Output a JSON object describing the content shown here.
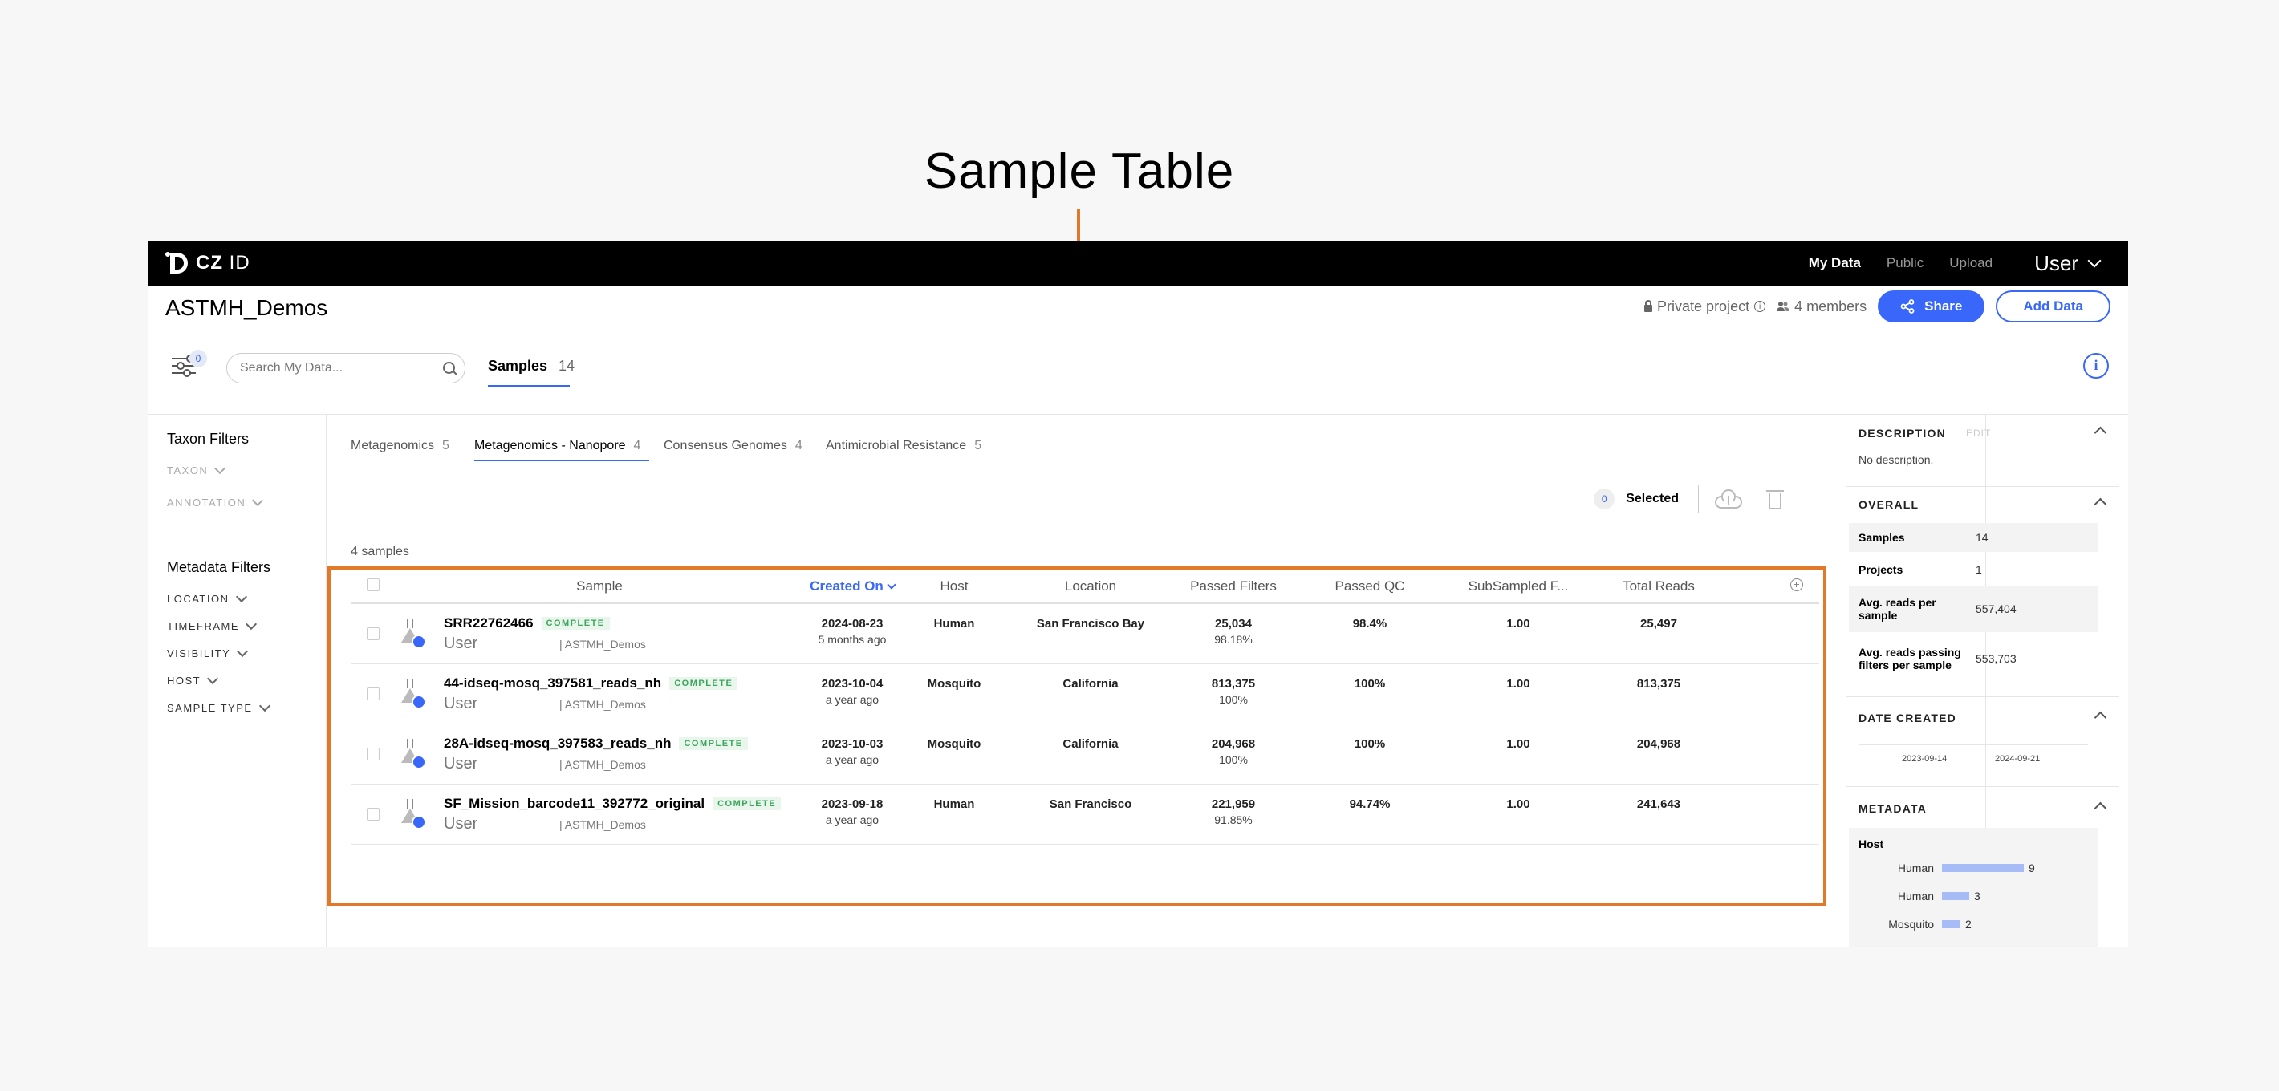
{
  "annotation": {
    "title": "Sample Table"
  },
  "nav": {
    "logo_bold": "CZ",
    "logo_light": "ID",
    "links": [
      "My Data",
      "Public",
      "Upload"
    ],
    "user": "User"
  },
  "header": {
    "project_name": "ASTMH_Demos",
    "privacy": "Private project",
    "members": "4 members",
    "share_label": "Share",
    "add_data_label": "Add Data",
    "filter_count": "0",
    "search_placeholder": "Search My Data...",
    "tab_label": "Samples",
    "tab_count": "14"
  },
  "filters": {
    "taxon_title": "Taxon Filters",
    "taxon_items": [
      "TAXON",
      "ANNOTATION"
    ],
    "metadata_title": "Metadata Filters",
    "metadata_items": [
      "LOCATION",
      "TIMEFRAME",
      "VISIBILITY",
      "HOST",
      "SAMPLE TYPE"
    ]
  },
  "workflow_tabs": [
    {
      "label": "Metagenomics",
      "count": "5"
    },
    {
      "label": "Metagenomics - Nanopore",
      "count": "4"
    },
    {
      "label": "Consensus Genomes",
      "count": "4"
    },
    {
      "label": "Antimicrobial Resistance",
      "count": "5"
    }
  ],
  "selection": {
    "count": "0",
    "label": "Selected"
  },
  "samples_count": "4 samples",
  "table": {
    "columns": [
      "Sample",
      "Created On",
      "Host",
      "Location",
      "Passed Filters",
      "Passed QC",
      "SubSampled F...",
      "Total Reads"
    ],
    "rows": [
      {
        "name": "SRR22762466",
        "status": "COMPLETE",
        "user": "User",
        "project": "| ASTMH_Demos",
        "date": "2024-08-23",
        "ago": "5 months ago",
        "host": "Human",
        "location": "San Francisco Bay",
        "passed_filters": "25,034",
        "passed_filters_pct": "98.18%",
        "passed_qc": "98.4%",
        "subsampled": "1.00",
        "total_reads": "25,497"
      },
      {
        "name": "44-idseq-mosq_397581_reads_nh",
        "status": "COMPLETE",
        "user": "User",
        "project": "| ASTMH_Demos",
        "date": "2023-10-04",
        "ago": "a year ago",
        "host": "Mosquito",
        "location": "California",
        "passed_filters": "813,375",
        "passed_filters_pct": "100%",
        "passed_qc": "100%",
        "subsampled": "1.00",
        "total_reads": "813,375"
      },
      {
        "name": "28A-idseq-mosq_397583_reads_nh",
        "status": "COMPLETE",
        "user": "User",
        "project": "| ASTMH_Demos",
        "date": "2023-10-03",
        "ago": "a year ago",
        "host": "Mosquito",
        "location": "California",
        "passed_filters": "204,968",
        "passed_filters_pct": "100%",
        "passed_qc": "100%",
        "subsampled": "1.00",
        "total_reads": "204,968"
      },
      {
        "name": "SF_Mission_barcode11_392772_original",
        "status": "COMPLETE",
        "user": "User",
        "project": "| ASTMH_Demos",
        "date": "2023-09-18",
        "ago": "a year ago",
        "host": "Human",
        "location": "San Francisco",
        "passed_filters": "221,959",
        "passed_filters_pct": "91.85%",
        "passed_qc": "94.74%",
        "subsampled": "1.00",
        "total_reads": "241,643"
      }
    ]
  },
  "sidebar": {
    "description_title": "DESCRIPTION",
    "edit_label": "EDIT",
    "description_text": "No description.",
    "overall_title": "OVERALL",
    "overall": [
      {
        "label": "Samples",
        "value": "14"
      },
      {
        "label": "Projects",
        "value": "1"
      },
      {
        "label": "Avg. reads per sample",
        "value": "557,404"
      },
      {
        "label": "Avg. reads passing filters per sample",
        "value": "553,703"
      }
    ],
    "date_created_title": "DATE CREATED",
    "date_start": "2023-09-14",
    "date_end": "2024-09-21",
    "metadata_title": "METADATA",
    "host_label": "Host",
    "host_histogram": [
      {
        "label": "Human",
        "count": 9
      },
      {
        "label": "Human",
        "count": 3
      },
      {
        "label": "Mosquito",
        "count": 2
      }
    ]
  },
  "colors": {
    "accent": "#3867fa",
    "callout": "#e0792a",
    "complete": "#3da55d"
  }
}
